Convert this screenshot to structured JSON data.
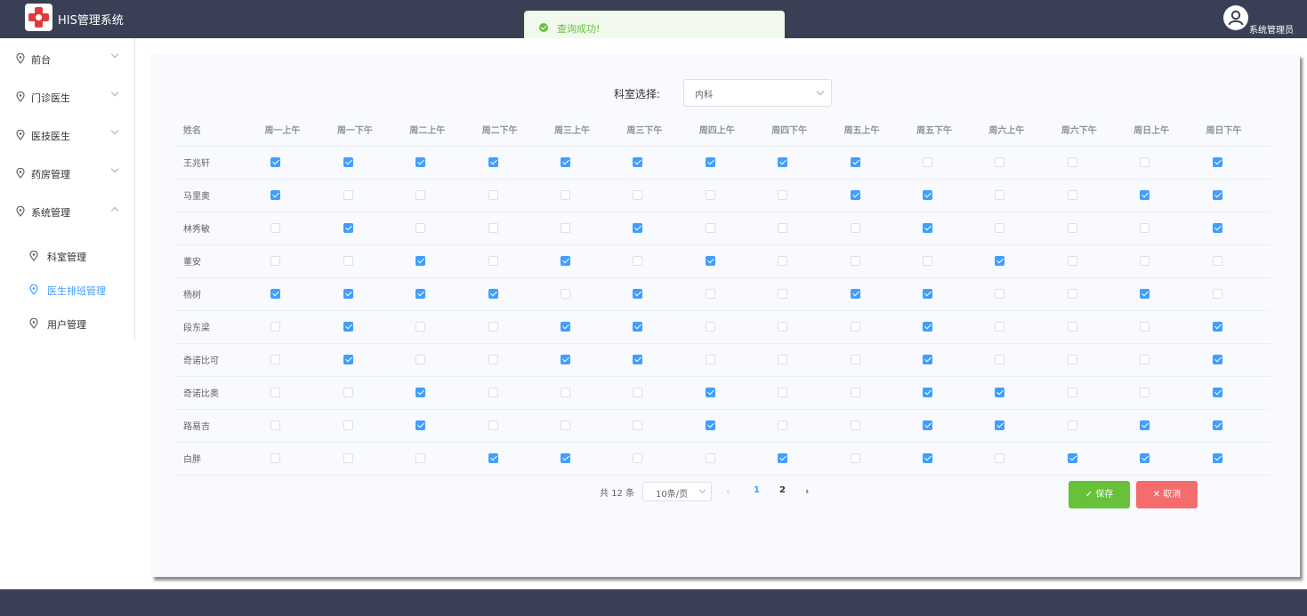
{
  "app": {
    "title": "HIS管理系统",
    "user": "系统管理员"
  },
  "toast": {
    "message": "查询成功!"
  },
  "sidebar": {
    "items": [
      {
        "label": "前台"
      },
      {
        "label": "门诊医生"
      },
      {
        "label": "医技医生"
      },
      {
        "label": "药房管理"
      },
      {
        "label": "系统管理"
      }
    ],
    "sub_items": [
      {
        "label": "科室管理"
      },
      {
        "label": "医生排班管理"
      },
      {
        "label": "用户管理"
      }
    ]
  },
  "filter": {
    "label": "科室选择:",
    "value": "内科"
  },
  "table": {
    "columns": [
      "姓名",
      "周一上午",
      "周一下午",
      "周二上午",
      "周二下午",
      "周三上午",
      "周三下午",
      "周四上午",
      "周四下午",
      "周五上午",
      "周五下午",
      "周六上午",
      "周六下午",
      "周日上午",
      "周日下午"
    ],
    "rows": [
      {
        "name": "王兆轩",
        "checks": [
          1,
          1,
          1,
          1,
          1,
          1,
          1,
          1,
          1,
          0,
          0,
          0,
          0,
          1
        ]
      },
      {
        "name": "马里奥",
        "checks": [
          1,
          0,
          0,
          0,
          0,
          0,
          0,
          0,
          1,
          1,
          0,
          0,
          1,
          1
        ]
      },
      {
        "name": "林秀敏",
        "checks": [
          0,
          1,
          0,
          0,
          0,
          1,
          0,
          0,
          0,
          1,
          0,
          0,
          0,
          1
        ]
      },
      {
        "name": "董安",
        "checks": [
          0,
          0,
          1,
          0,
          1,
          0,
          1,
          0,
          0,
          0,
          1,
          0,
          0,
          0
        ]
      },
      {
        "name": "杨树",
        "checks": [
          1,
          1,
          1,
          1,
          0,
          1,
          0,
          0,
          1,
          1,
          0,
          0,
          1,
          0
        ]
      },
      {
        "name": "段东梁",
        "checks": [
          0,
          1,
          0,
          0,
          1,
          1,
          0,
          0,
          0,
          1,
          0,
          0,
          0,
          1
        ]
      },
      {
        "name": "奇诺比可",
        "checks": [
          0,
          1,
          0,
          0,
          1,
          1,
          0,
          0,
          0,
          1,
          0,
          0,
          0,
          1
        ]
      },
      {
        "name": "奇诺比奥",
        "checks": [
          0,
          0,
          1,
          0,
          0,
          0,
          1,
          0,
          0,
          1,
          1,
          0,
          0,
          1
        ]
      },
      {
        "name": "路易吉",
        "checks": [
          0,
          0,
          1,
          0,
          0,
          0,
          1,
          0,
          0,
          1,
          1,
          0,
          1,
          1
        ]
      },
      {
        "name": "白胖",
        "checks": [
          0,
          0,
          0,
          1,
          1,
          0,
          0,
          1,
          0,
          1,
          0,
          1,
          1,
          1
        ]
      }
    ]
  },
  "pagination": {
    "total": "共 12 条",
    "page_size": "10条/页",
    "prev": "‹",
    "next": "›",
    "pages": [
      "1",
      "2"
    ]
  },
  "buttons": {
    "save": "✓ 保存",
    "cancel": "✕ 取消"
  }
}
